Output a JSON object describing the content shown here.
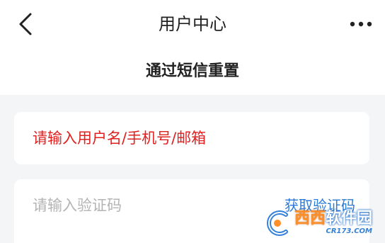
{
  "header": {
    "title": "用户中心",
    "back_icon": "chevron-left-icon",
    "more_icon": "more-horizontal-icon"
  },
  "subtitle": "通过短信重置",
  "form": {
    "account_value": "请输入用户名/手机号/邮箱",
    "code_placeholder": "请输入验证码",
    "get_code_label": "获取验证码"
  },
  "watermark": {
    "brand_accent": "西西",
    "brand_main": "软件园",
    "site": "CR173.COM"
  },
  "colors": {
    "accent_red": "#e02020",
    "link_blue": "#2a7bd8",
    "background": "#f4f5f7"
  }
}
